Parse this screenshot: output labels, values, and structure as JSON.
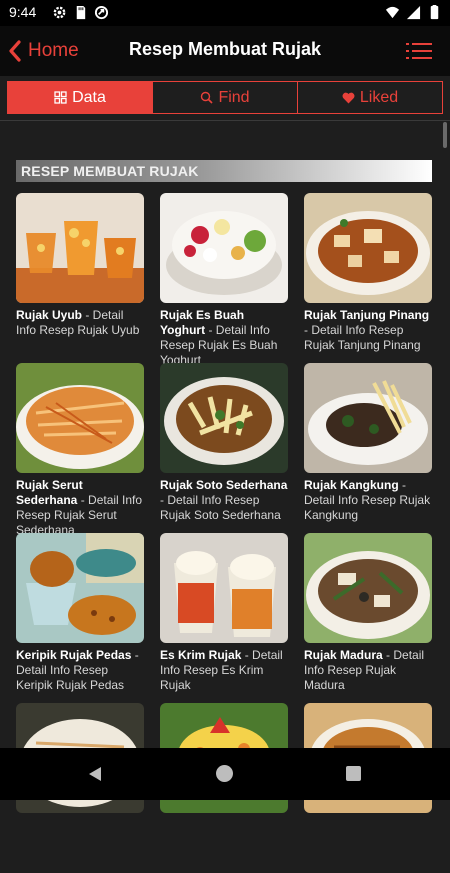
{
  "status": {
    "time": "9:44"
  },
  "appbar": {
    "back_label": "Home",
    "title": "Resep Membuat Rujak"
  },
  "tabs": [
    {
      "label": "Data",
      "active": true
    },
    {
      "label": "Find",
      "active": false
    },
    {
      "label": "Liked",
      "active": false
    }
  ],
  "section_title": "RESEP MEMBUAT RUJAK",
  "recipes": [
    {
      "name": "Rujak Uyub",
      "desc": " - Detail Info Resep Rujak Uyub"
    },
    {
      "name": "Rujak Es Buah Yoghurt",
      "desc": " - Detail Info Resep Rujak Es Buah Yoghurt"
    },
    {
      "name": "Rujak Tanjung Pinang",
      "desc": " - Detail Info Resep Rujak Tanjung Pinang"
    },
    {
      "name": "Rujak Serut Sederhana",
      "desc": " - Detail Info Resep Rujak Serut Sederhana"
    },
    {
      "name": "Rujak Soto Sederhana",
      "desc": " - Detail Info Resep Rujak Soto Sederhana"
    },
    {
      "name": "Rujak Kangkung",
      "desc": " - Detail Info Resep Rujak Kangkung"
    },
    {
      "name": "Keripik Rujak Pedas",
      "desc": " - Detail Info Resep Keripik Rujak Pedas"
    },
    {
      "name": "Es Krim Rujak",
      "desc": " - Detail Info Resep Es Krim Rujak"
    },
    {
      "name": "Rujak Madura",
      "desc": " - Detail Info Resep Rujak Madura"
    },
    {
      "name": "",
      "desc": ""
    },
    {
      "name": "",
      "desc": ""
    },
    {
      "name": "",
      "desc": ""
    }
  ],
  "colors": {
    "accent": "#e8413a",
    "background": "#1e1e1e",
    "appbar": "#0b0b0b"
  }
}
